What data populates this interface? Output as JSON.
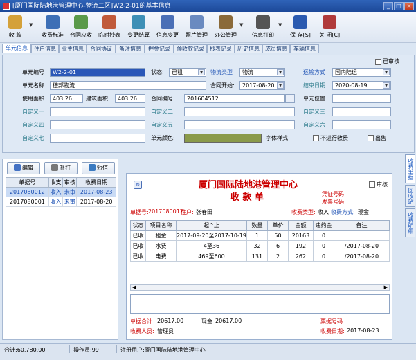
{
  "window": {
    "title": "[厦门国际陆地港管理中心-物流二区]W2-2-01的基本信息"
  },
  "toolbar": {
    "items": [
      {
        "label": "收 款",
        "icon": "receive-money-icon",
        "color": "#d4a13a"
      },
      {
        "label": "收费标准",
        "icon": "fee-standard-icon",
        "color": "#3d6fb6"
      },
      {
        "label": "合同应收",
        "icon": "contract-receivable-icon",
        "color": "#5a9a4a"
      },
      {
        "label": "临时抄表",
        "icon": "meter-reading-icon",
        "color": "#c05a3a"
      },
      {
        "label": "变更结算",
        "icon": "change-settlement-icon",
        "color": "#3d8fb6"
      },
      {
        "label": "信息变更",
        "icon": "info-change-icon",
        "color": "#4a6fb6"
      },
      {
        "label": "照片管理",
        "icon": "photo-management-icon",
        "color": "#6a8ac0"
      },
      {
        "label": "办公管理",
        "icon": "office-management-icon",
        "color": "#8a6a3a"
      },
      {
        "label": "信息打印",
        "icon": "printer-icon",
        "color": "#555555"
      },
      {
        "label": "保 存[S]",
        "icon": "save-icon",
        "color": "#2a5ab0"
      },
      {
        "label": "关 闭[C]",
        "icon": "close-door-icon",
        "color": "#b03a3a"
      }
    ]
  },
  "tabs": [
    "单元信息",
    "住户信息",
    "业主信息",
    "合同协议",
    "备注信息",
    "押金记录",
    "预收款记录",
    "抄表记录",
    "历史信息",
    "成员信息",
    "车辆信息"
  ],
  "form": {
    "audited_label": "已审核",
    "unit_no_label": "单元编号",
    "unit_no": "W2-2-01",
    "status_label": "状态:",
    "status": "已租",
    "logistics_type_label": "物流类型",
    "logistics_type": "物流",
    "transport_label": "运输方式",
    "transport": "国内陆运",
    "unit_name_label": "单元名称",
    "unit_name": "德邦物流",
    "contract_start_label": "合同开始:",
    "contract_start": "2017-08-20",
    "end_date_label": "结束日期",
    "end_date": "2020-08-19",
    "use_area_label": "使用面积",
    "use_area": "403.26",
    "build_area_label": "建筑面积",
    "build_area": "403.26",
    "contract_no_label": "合同编号:",
    "contract_no": "201604512",
    "browse_label": "...",
    "unit_position_label": "单元位置:",
    "custom1": "自定义一",
    "custom2": "自定义二",
    "custom3": "自定义三",
    "custom4": "自定义四",
    "custom5": "自定义五",
    "custom6": "自定义六",
    "custom7": "自定义七",
    "unit_color_label": "单元颜色:",
    "unit_color": "#8a9a4a",
    "font_style_label": "字体样式",
    "no_fee_label": "不进行收费",
    "for_sale_label": "出售"
  },
  "left": {
    "edit_label": "编辑",
    "reprint_label": "补打",
    "sms_label": "短信",
    "columns": [
      "单据号",
      "收支",
      "审核",
      "收费日期"
    ],
    "rows": [
      {
        "no": "2017080012",
        "type": "收入",
        "audit": "未审",
        "date": "2017-08-23"
      },
      {
        "no": "2017080001",
        "type": "收入",
        "audit": "未审",
        "date": "2017-08-20"
      }
    ]
  },
  "receipt": {
    "company": "厦门国际陆地港管理中心",
    "title": "收 款 单",
    "audited_label": "审核",
    "voucher_no_label": "凭证号码",
    "invoice_no_label": "发票号码",
    "doc_no_label": "单据号:",
    "doc_no": "2017080012",
    "resident_label": "住户:",
    "resident": "张春田",
    "fee_type_label": "收费类型:",
    "fee_type": "收入",
    "pay_method_label": "收费方式:",
    "pay_method": "现金",
    "columns": [
      "状态",
      "项目名称",
      "起^止",
      "数量",
      "单价",
      "金额",
      "违约金",
      "备注"
    ],
    "rows": [
      {
        "status": "已收",
        "item": "租金",
        "range": "2017-09-20至2017-10-19",
        "qty": "1",
        "price": "50",
        "amount": "20163",
        "penalty": "0",
        "note": ""
      },
      {
        "status": "已收",
        "item": "水费",
        "range": "4至36",
        "qty": "32",
        "price": "6",
        "amount": "192",
        "penalty": "0",
        "note": "/2017-08-20"
      },
      {
        "status": "已收",
        "item": "电费",
        "range": "469至600",
        "qty": "131",
        "price": "2",
        "amount": "262",
        "penalty": "0",
        "note": "/2017-08-20"
      }
    ],
    "total_label": "单据合计:",
    "total": "20617.00",
    "cash_label": "现金:",
    "cash": "20617.00",
    "ticket_no_label": "票据号码",
    "collector_label": "收费人员:",
    "collector": "管理员",
    "collect_date_label": "收费日期:",
    "collect_date": "2017-08-23"
  },
  "vtabs": [
    "收费单据",
    "回收站",
    "收费明细"
  ],
  "status": {
    "total": "合计:60,780.00",
    "operator": "操作员:99",
    "registered": "注册用户:厦门国际陆地港管理中心"
  }
}
